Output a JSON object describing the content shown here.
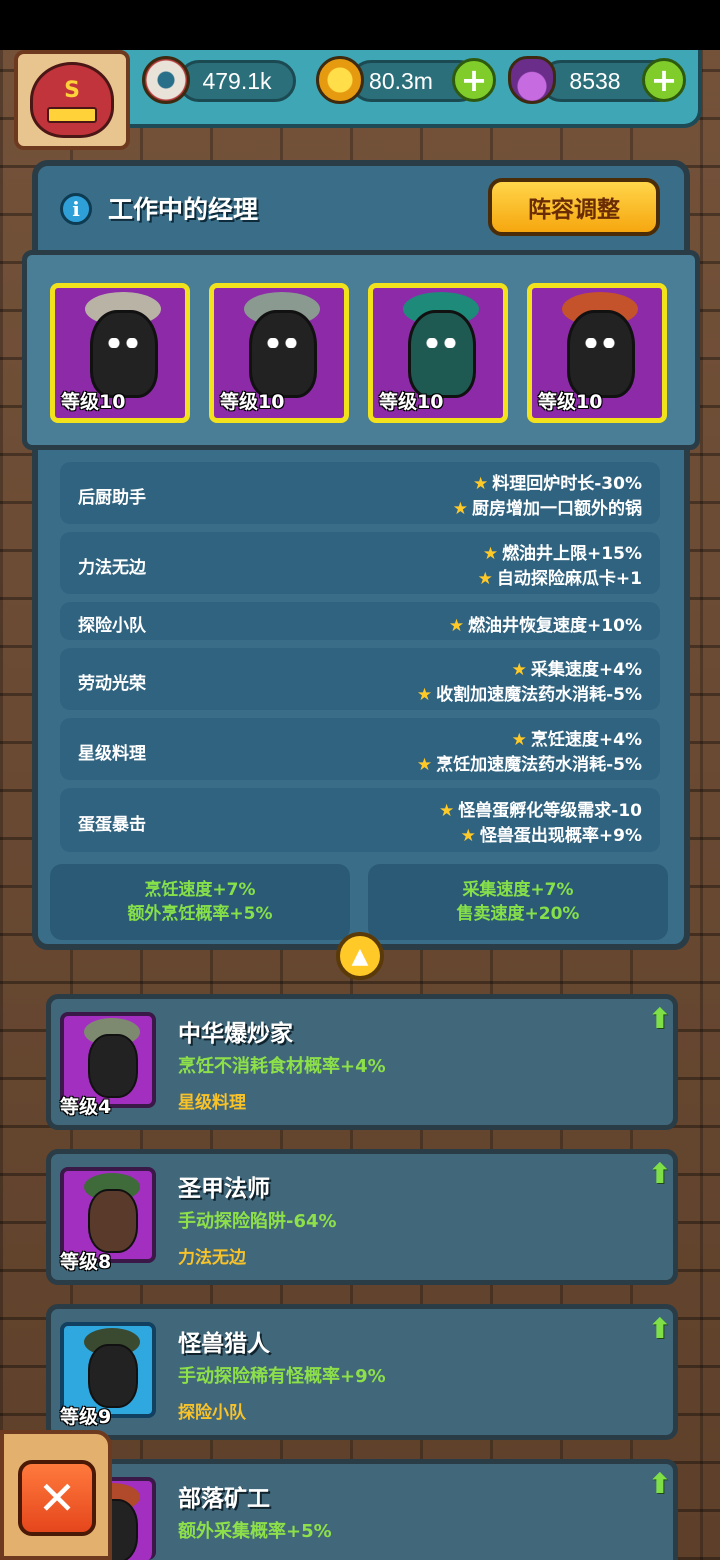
{
  "resources": {
    "eyes": "479.1k",
    "coins": "80.3m",
    "potions": "8538"
  },
  "emblem": {
    "letter": "S"
  },
  "panel": {
    "title": "工作中的经理",
    "lineup_button": "阵容调整"
  },
  "cards": [
    {
      "level": "等级10"
    },
    {
      "level": "等级10"
    },
    {
      "level": "等级10"
    },
    {
      "level": "等级10"
    }
  ],
  "bonuses": [
    {
      "name": "后厨助手",
      "effects": [
        "料理回炉时长-30%",
        "厨房增加一口额外的锅"
      ]
    },
    {
      "name": "力法无边",
      "effects": [
        "燃油井上限+15%",
        "自动探险麻瓜卡+1"
      ]
    },
    {
      "name": "探险小队",
      "effects": [
        "燃油井恢复速度+10%"
      ]
    },
    {
      "name": "劳动光荣",
      "effects": [
        "采集速度+4%",
        "收割加速魔法药水消耗-5%"
      ]
    },
    {
      "name": "星级料理",
      "effects": [
        "烹饪速度+4%",
        "烹饪加速魔法药水消耗-5%"
      ]
    },
    {
      "name": "蛋蛋暴击",
      "effects": [
        "怪兽蛋孵化等级需求-10",
        "怪兽蛋出现概率+9%"
      ]
    }
  ],
  "summary": {
    "left": [
      "烹饪速度+7%",
      "额外烹饪概率+5%"
    ],
    "right": [
      "采集速度+7%",
      "售卖速度+20%"
    ]
  },
  "managers": [
    {
      "name": "中华爆炒家",
      "effect": "烹饪不消耗食材概率+4%",
      "group": "星级料理",
      "level": "等级4",
      "frame": "#a32fc0"
    },
    {
      "name": "圣甲法师",
      "effect": "手动探险陷阱-64%",
      "group": "力法无边",
      "level": "等级8",
      "frame": "#a32fc0"
    },
    {
      "name": "怪兽猎人",
      "effect": "手动探险稀有怪概率+9%",
      "group": "探险小队",
      "level": "等级9",
      "frame": "#2fa8e0"
    },
    {
      "name": "部落矿工",
      "effect": "额外采集概率+5%",
      "group": "",
      "level": "",
      "frame": "#a32fc0"
    }
  ],
  "icons": {
    "eye": "eyeball-icon",
    "coin": "coin-icon",
    "potion": "potion-icon",
    "info": "info-icon",
    "close": "close-icon"
  },
  "colors": {
    "effect_green": "#8de04a",
    "group_gold": "#f7c22a",
    "card_purple": "#8d2aa8",
    "card_border": "#f1e21c"
  }
}
